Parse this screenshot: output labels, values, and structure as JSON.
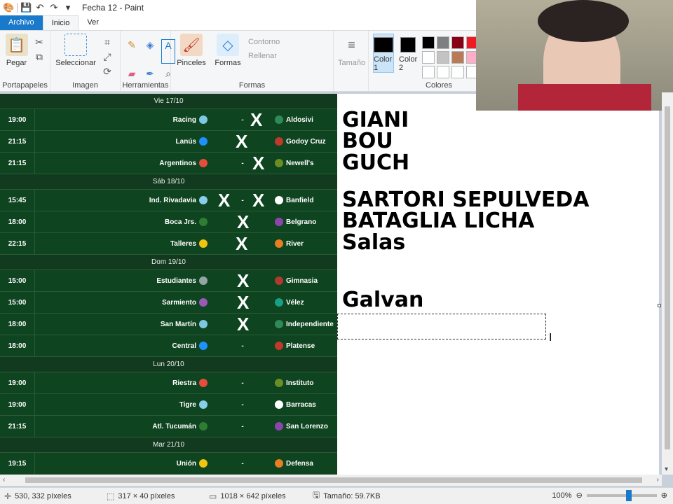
{
  "window": {
    "title": "Fecha 12 - Paint"
  },
  "tabs": [
    "Archivo",
    "Inicio",
    "Ver"
  ],
  "ribbon": {
    "portapapeles": {
      "label": "Portapapeles",
      "paste": "Pegar"
    },
    "imagen": {
      "label": "Imagen",
      "select": "Seleccionar"
    },
    "herramientas": {
      "label": "Herramientas"
    },
    "formas": {
      "label": "Formas",
      "brushes": "Pinceles",
      "shapes": "Formas",
      "outline": "Contorno",
      "fill": "Rellenar"
    },
    "tamano": "Tamaño",
    "colores": {
      "label": "Colores",
      "color1": "Color 1",
      "color2": "Color 2"
    },
    "palette": [
      "#000000",
      "#7f7f7f",
      "#880015",
      "#ed1c24",
      "#ff7f27",
      "#fff200",
      "#ffffff",
      "#c3c3c3",
      "#b97a57",
      "#ffaec9",
      "#ffc90e",
      "#efe4b0",
      "#ffffff",
      "#ffffff",
      "#ffffff",
      "#ffffff",
      "#ffffff",
      "#ffffff"
    ]
  },
  "fixtures": {
    "days": [
      {
        "label": "Vie 17/10",
        "matches": [
          {
            "time": "19:00",
            "home": "Racing",
            "sep": "-",
            "away": "Aldosivi"
          },
          {
            "time": "21:15",
            "home": "Lanús",
            "sep": "-",
            "away": "Godoy Cruz"
          },
          {
            "time": "21:15",
            "home": "Argentinos",
            "sep": "-",
            "away": "Newell's"
          }
        ]
      },
      {
        "label": "Sáb 18/10",
        "matches": [
          {
            "time": "15:45",
            "home": "Ind. Rivadavia",
            "sep": "-",
            "away": "Banfield"
          },
          {
            "time": "18:00",
            "home": "Boca Jrs.",
            "sep": "-",
            "away": "Belgrano"
          },
          {
            "time": "22:15",
            "home": "Talleres",
            "sep": "-",
            "away": "River"
          }
        ]
      },
      {
        "label": "Dom 19/10",
        "matches": [
          {
            "time": "15:00",
            "home": "Estudiantes",
            "sep": "-",
            "away": "Gimnasia"
          },
          {
            "time": "15:00",
            "home": "Sarmiento",
            "sep": "-",
            "away": "Vélez"
          },
          {
            "time": "18:00",
            "home": "San Martín",
            "sep": "-",
            "away": "Independiente"
          },
          {
            "time": "18:00",
            "home": "Central",
            "sep": "-",
            "away": "Platense"
          }
        ]
      },
      {
        "label": "Lun 20/10",
        "matches": [
          {
            "time": "19:00",
            "home": "Riestra",
            "sep": "-",
            "away": "Instituto"
          },
          {
            "time": "19:00",
            "home": "Tigre",
            "sep": "-",
            "away": "Barracas"
          },
          {
            "time": "21:15",
            "home": "Atl. Tucumán",
            "sep": "-",
            "away": "San Lorenzo"
          }
        ]
      },
      {
        "label": "Mar 21/10",
        "matches": [
          {
            "time": "19:15",
            "home": "Unión",
            "sep": "-",
            "away": "Defensa"
          }
        ]
      }
    ],
    "mark": "X"
  },
  "annotations": [
    "GIANI",
    "BOU",
    "GUCH",
    "SARTORI SEPULVEDA",
    "BATAGLIA LICHA",
    "Salas",
    "Galvan"
  ],
  "status": {
    "cursor_pos": "530, 332 píxeles",
    "selection_size": "317 × 40 píxeles",
    "image_size": "1018 × 642 píxeles",
    "file_size": "Tamaño: 59.7KB",
    "zoom": "100%"
  }
}
